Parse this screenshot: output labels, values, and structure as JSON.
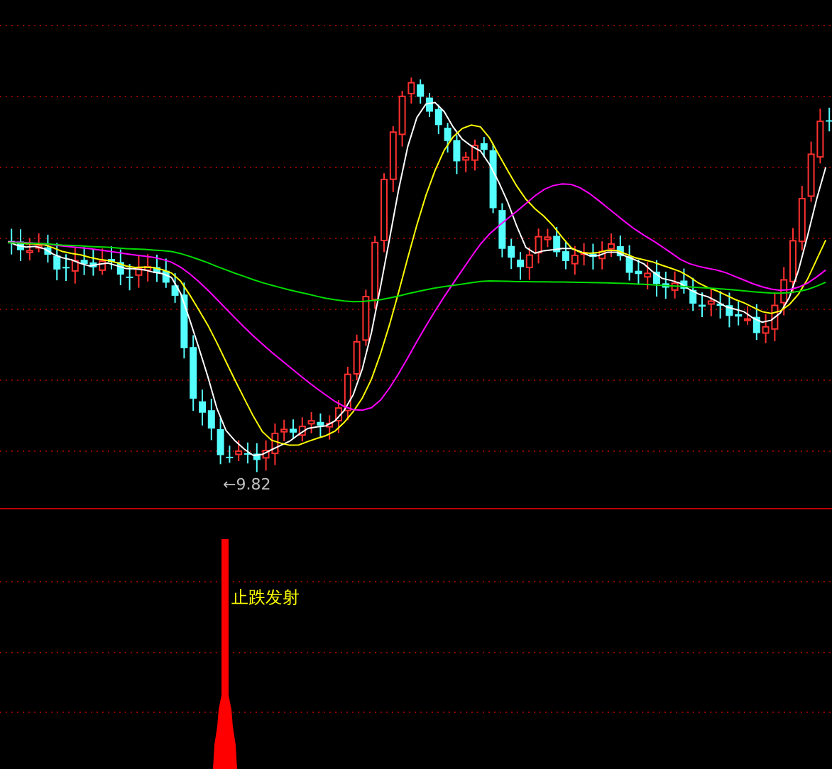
{
  "price_chart": {
    "low_label": "←9.82"
  },
  "indicator": {
    "signal_label": "止跌发射"
  }
}
